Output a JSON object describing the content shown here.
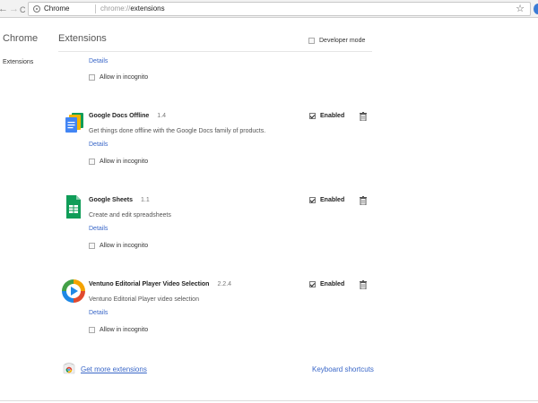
{
  "browser": {
    "back_glyph": "←",
    "forward_glyph": "→",
    "reload_glyph": "C",
    "chip_label": "Chrome",
    "url_scheme": "chrome://",
    "url_path": "extensions",
    "star_glyph": "☆"
  },
  "sidebar": {
    "title": "Chrome",
    "items": [
      {
        "label": "Extensions"
      }
    ]
  },
  "header": {
    "title": "Extensions",
    "developer_mode_label": "Developer mode",
    "developer_mode_checked": false
  },
  "partial_item": {
    "details_label": "Details",
    "incognito_label": "Allow in incognito"
  },
  "extensions": [
    {
      "name": "Google Docs Offline",
      "version": "1.4",
      "description": "Get things done offline with the Google Docs family of products.",
      "details_label": "Details",
      "incognito_label": "Allow in incognito",
      "enabled_label": "Enabled",
      "enabled": true,
      "icon": "google-docs-offline-icon"
    },
    {
      "name": "Google Sheets",
      "version": "1.1",
      "description": "Create and edit spreadsheets",
      "details_label": "Details",
      "incognito_label": "Allow in incognito",
      "enabled_label": "Enabled",
      "enabled": true,
      "icon": "google-sheets-icon"
    },
    {
      "name": "Ventuno Editorial Player Video Selection",
      "version": "2.2.4",
      "description": "Ventuno Editorial Player video selection",
      "details_label": "Details",
      "incognito_label": "Allow in incognito",
      "enabled_label": "Enabled",
      "enabled": true,
      "icon": "ventuno-player-icon"
    }
  ],
  "footer": {
    "get_more_label": "Get more extensions",
    "keyboard_shortcuts_label": "Keyboard shortcuts"
  },
  "colors": {
    "link": "#3a67c8",
    "docs_blue": "#4285f4",
    "sheets_green": "#0f9d58"
  }
}
